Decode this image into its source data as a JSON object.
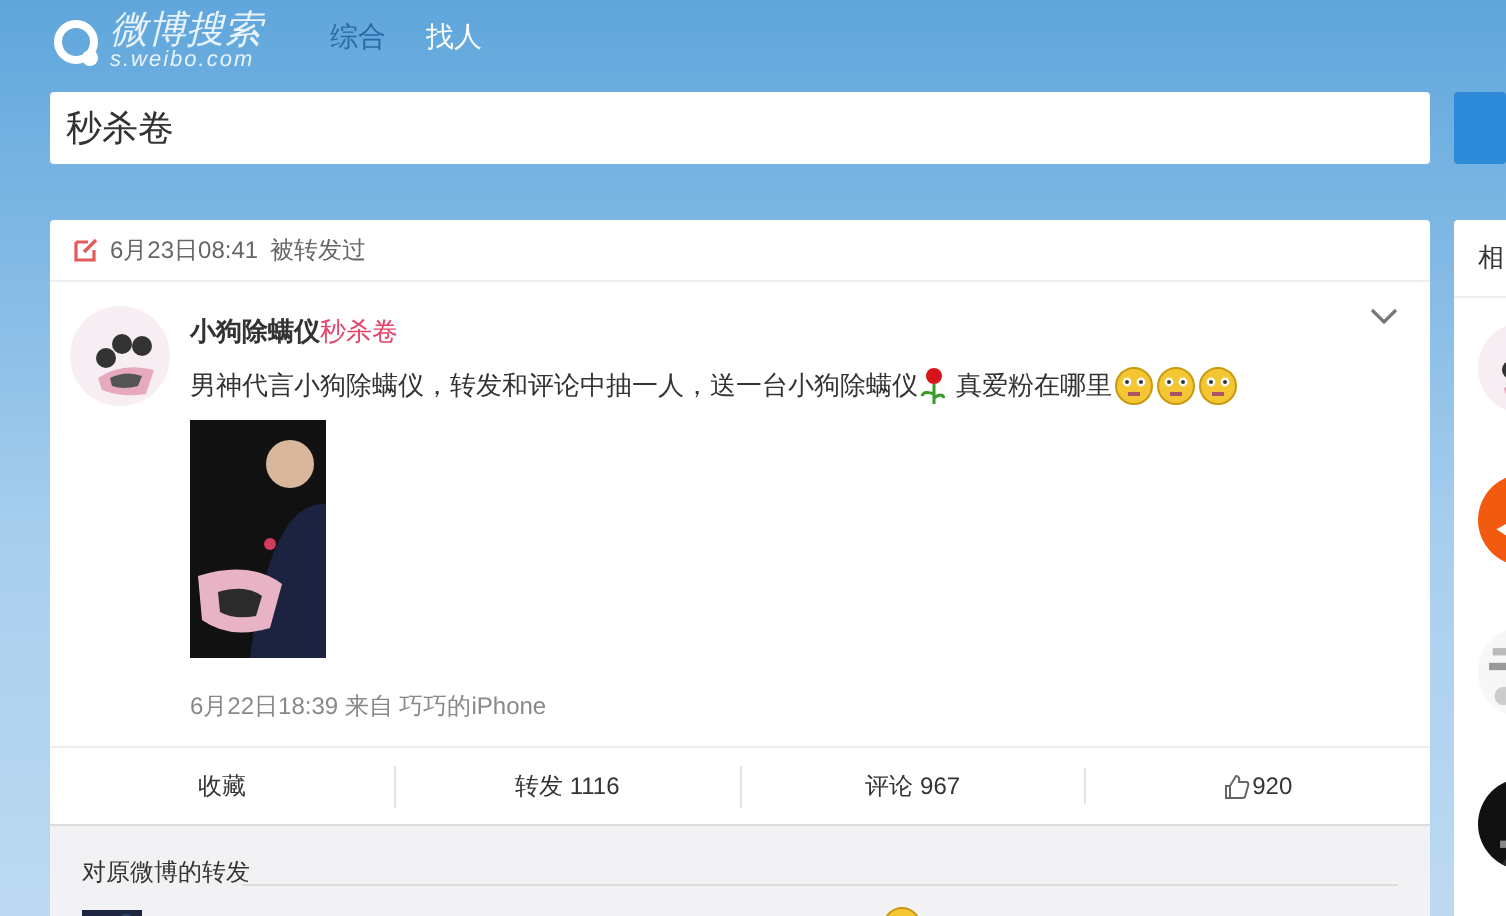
{
  "logo": {
    "title": "微博搜索",
    "url": "s.weibo.com"
  },
  "nav": [
    {
      "label": "综合",
      "selected": true
    },
    {
      "label": "找人",
      "selected": false
    }
  ],
  "search": {
    "value": "秒杀卷"
  },
  "post": {
    "header_time": "6月23日08:41",
    "header_note": "被转发过",
    "author": "小狗除螨仪",
    "keyword": "秒杀卷",
    "text": "男神代言小狗除螨仪，转发和评论中抽一人，送一台小狗除螨仪",
    "text_after": "真爱粉在哪里",
    "emojis": [
      {
        "kind": "emoji"
      },
      {
        "kind": "emoji"
      },
      {
        "kind": "emoji"
      }
    ],
    "source": "6月22日18:39 来自 巧巧的iPhone",
    "actions": [
      {
        "kind": "text",
        "label": "收藏"
      },
      {
        "kind": "text",
        "label": "转发 1116"
      },
      {
        "kind": "text",
        "label": "评论 967"
      },
      {
        "kind": "like",
        "label": "920"
      }
    ],
    "repost_title": "对原微博的转发"
  },
  "sidebar": {
    "heading": "相"
  }
}
